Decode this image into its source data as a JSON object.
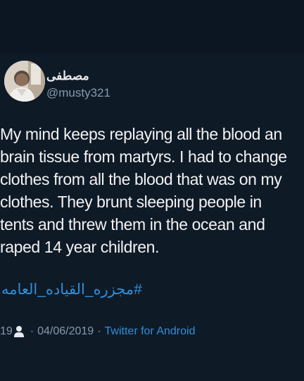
{
  "tweet": {
    "display_name": "مصطفى",
    "handle": "@musty321",
    "body_lines": [
      "My mind keeps replaying all the blood an",
      "brain tissue from martyrs. I had to change",
      "clothes from all the blood that was on my",
      "clothes. They brunt sleeping people in",
      "tents and threw them in the ocean and",
      "raped 14 year children."
    ],
    "hashtag": "#مجزره_القياده_العامه",
    "meta": {
      "count": "19",
      "separator_1": "·",
      "date": "04/06/2019",
      "separator_2": "·",
      "source": "Twitter for Android"
    }
  },
  "colors": {
    "background": "#0c1622",
    "tweet_background": "#0f1a27",
    "text": "#f2f2f2",
    "muted": "#8899a6",
    "link": "#2f8fd8"
  },
  "icons": {
    "avatar": "profile-photo",
    "meta_person": "person-icon"
  }
}
